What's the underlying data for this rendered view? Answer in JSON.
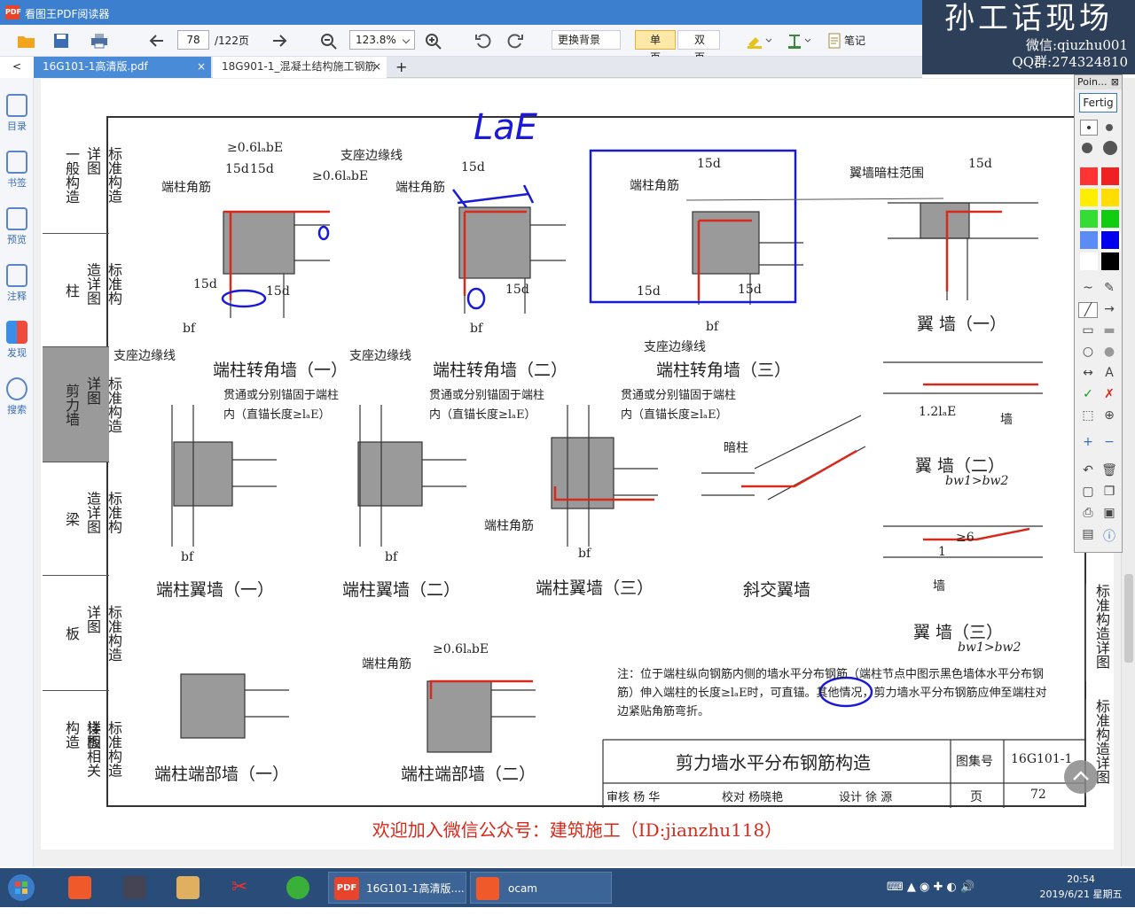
{
  "app": {
    "title": "看图王PDF阅读器",
    "logo": "PDF"
  },
  "toolbar": {
    "page_current": "78",
    "page_total": "/122页",
    "zoom": "123.8%",
    "background_btn": "更换背景",
    "single_page": "单页",
    "double_page": "双页",
    "notes": "笔记",
    "icons": [
      "open-folder-icon",
      "save-icon",
      "print-icon",
      "back-arrow-icon",
      "forward-arrow-icon",
      "zoom-out-icon",
      "zoom-in-icon",
      "rotate-left-icon",
      "rotate-right-icon",
      "highlighter-icon",
      "text-icon",
      "notes-icon"
    ]
  },
  "tabs": [
    {
      "label": "16G101-1高清版.pdf",
      "close": "×"
    },
    {
      "label": "18G901-1_混凝土结构施工钢筋",
      "close": "×"
    }
  ],
  "new_tab": "+",
  "collapse": "<",
  "sidebar": [
    "目录",
    "书签",
    "预览",
    "注释",
    "发现",
    "搜索"
  ],
  "watermark": {
    "title": "孙工话现场",
    "wechat": "微信:qiuzhu001",
    "qq": "QQ群:274324810"
  },
  "pointer_panel": {
    "title": "Poin...",
    "close": "⊠",
    "fertig": "Fertig",
    "colors": [
      "#ff3333",
      "#ee2222",
      "#ffee00",
      "#ffdd00",
      "#33dd33",
      "#11cc11",
      "#5b8cf5",
      "#0000ee",
      "#ffffff",
      "#000000"
    ]
  },
  "document": {
    "rail": [
      {
        "a": "一般构造",
        "b": "标准构造详图"
      },
      {
        "a": "柱",
        "b": "标准构造详图"
      },
      {
        "a": "剪力墙",
        "b": "标准构造详图",
        "selected": true
      },
      {
        "a": "梁",
        "b": "标准构造详图"
      },
      {
        "a": "板",
        "b": "标准构造详图"
      },
      {
        "a": "楼板相关构造",
        "b": "标准构造详图"
      }
    ],
    "right_rail": [
      "标准构造详图",
      "标准构造详图"
    ],
    "captions": [
      "端柱转角墙（一）",
      "端柱转角墙（二）",
      "端柱转角墙（三）",
      "翼 墙（一）",
      "端柱翼墙（一）",
      "端柱翼墙（二）",
      "端柱翼墙（三）",
      "斜交翼墙",
      "翼 墙（二）",
      "翼 墙（三）",
      "端柱端部墙（一）",
      "端柱端部墙（二）"
    ],
    "labels": {
      "corner_bar": "端柱角筋",
      "support_line": "支座边缘线",
      "wing_range": "翼墙暗柱范围",
      "anchor_note": "贯通或分别锚固于端柱",
      "anchor_note2": "内（直锚长度≥lₐE）",
      "hidden_col": "暗柱",
      "wall": "墙",
      "d15": "15d",
      "lab06": "≥0.6lₐbE",
      "bw": "bw",
      "bf": "bf",
      "bw1gt": "bw1>bw2",
      "l12": "1.2lₐE",
      "ge6": "≥6",
      "one": "1"
    },
    "annotation": "LaE",
    "note": "注：位于端柱纵向钢筋内侧的墙水平分布钢筋（端柱节点中图示黑色墙体水平分布钢筋）伸入端柱的长度≥lₐE时，可直锚。其他情况，剪力墙水平分布钢筋应伸至端柱对边紧贴角筋弯折。",
    "title_block": {
      "title": "剪力墙水平分布钢筋构造",
      "atlas_label": "图集号",
      "atlas_no": "16G101-1",
      "review": "审核 杨 华",
      "check": "校对 杨晓艳",
      "design": "设计 徐 源",
      "page_label": "页",
      "page_no": "72"
    },
    "promo": "欢迎加入微信公众号：建筑施工（ID:jianzhu118）"
  },
  "taskbar": {
    "items": [
      "16G101-1高清版....",
      "ocam"
    ],
    "time": "20:54",
    "date": "2019/6/21 星期五"
  }
}
